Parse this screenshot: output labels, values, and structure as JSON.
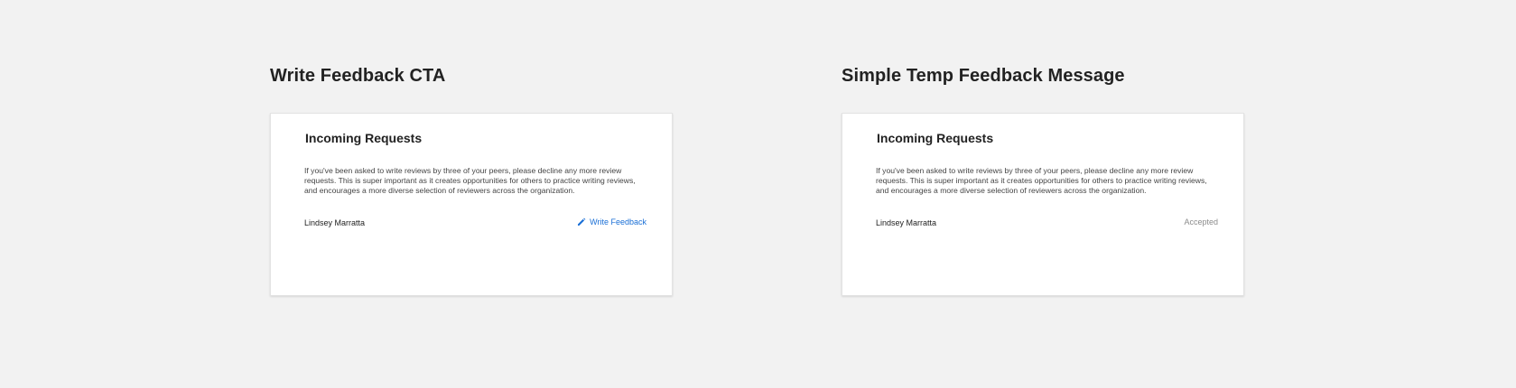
{
  "left": {
    "section_title": "Write Feedback CTA",
    "card": {
      "title": "Incoming Requests",
      "description": "If you've been asked to write reviews by three of your peers, please decline any more review requests. This is super important as it creates opportunities for others to practice writing reviews, and encourages a more diverse selection of reviewers across the organization.",
      "request": {
        "name": "Lindsey Marratta",
        "action_label": "Write Feedback",
        "action_icon": "pencil-icon"
      }
    }
  },
  "right": {
    "section_title": "Simple Temp Feedback Message",
    "card": {
      "title": "Incoming Requests",
      "description": "If you've been asked to write reviews by three of your peers, please decline any more review requests. This is super important as it creates opportunities for others to practice writing reviews, and encourages a more diverse selection of reviewers across the organization.",
      "request": {
        "name": "Lindsey Marratta",
        "status": "Accepted"
      }
    }
  },
  "colors": {
    "background": "#f2f2f2",
    "card": "#ffffff",
    "link": "#1a6fd6",
    "muted": "#8c8c8c"
  }
}
